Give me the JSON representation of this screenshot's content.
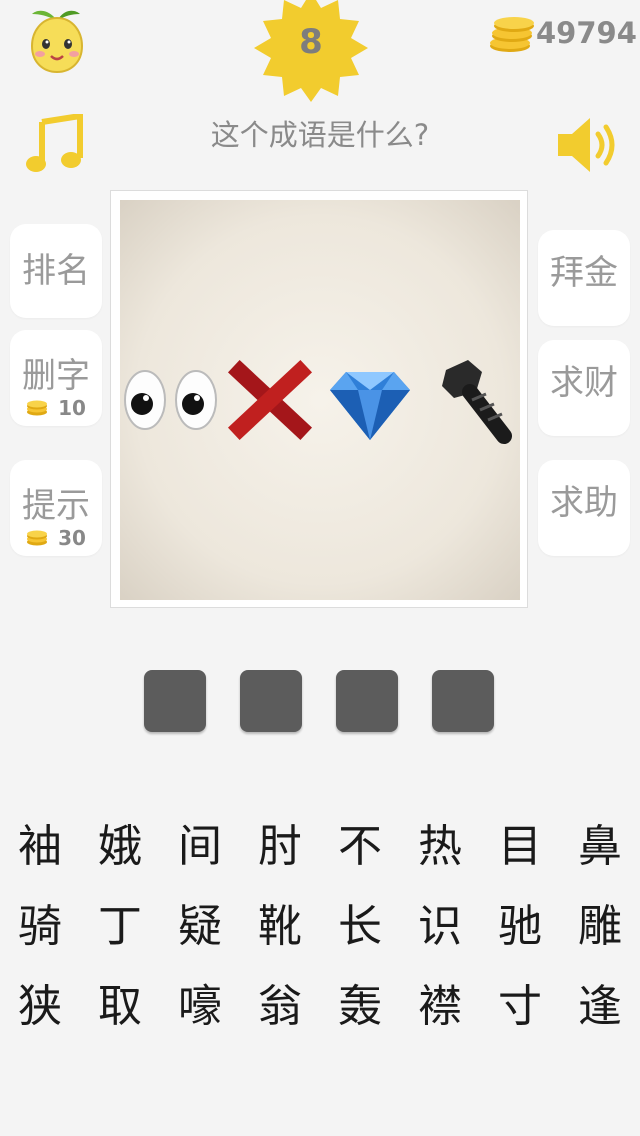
{
  "header": {
    "level": "8",
    "coins": "49794",
    "question": "这个成语是什么?"
  },
  "icons": {
    "avatar": "pear-character-avatar",
    "level_badge": "yellow-star-badge",
    "coins": "gold-coin-stack-icon",
    "music": "music-note-icon",
    "sound": "speaker-icon"
  },
  "left_buttons": [
    {
      "label": "排名"
    },
    {
      "label": "删字",
      "cost": "10"
    },
    {
      "label": "提示",
      "cost": "30"
    }
  ],
  "right_buttons": [
    {
      "label": "拜金"
    },
    {
      "label": "求财"
    },
    {
      "label": "求助"
    }
  ],
  "puzzle": {
    "emojis": [
      "eyes-emoji",
      "red-cross-emoji",
      "blue-diamond-emoji",
      "black-bolt-emoji"
    ]
  },
  "answer_slots": [
    "",
    "",
    "",
    ""
  ],
  "characters": [
    [
      "袖",
      "娥",
      "间",
      "肘",
      "不",
      "热",
      "目",
      "鼻"
    ],
    [
      "骑",
      "丁",
      "疑",
      "靴",
      "长",
      "识",
      "驰",
      "雕"
    ],
    [
      "狭",
      "取",
      "嚎",
      "翁",
      "轰",
      "襟",
      "寸",
      "逢"
    ]
  ],
  "colors": {
    "accent_yellow": "#f2cc2e",
    "slot_gray": "#5c5c5c",
    "text_gray": "#8a8a8a"
  }
}
